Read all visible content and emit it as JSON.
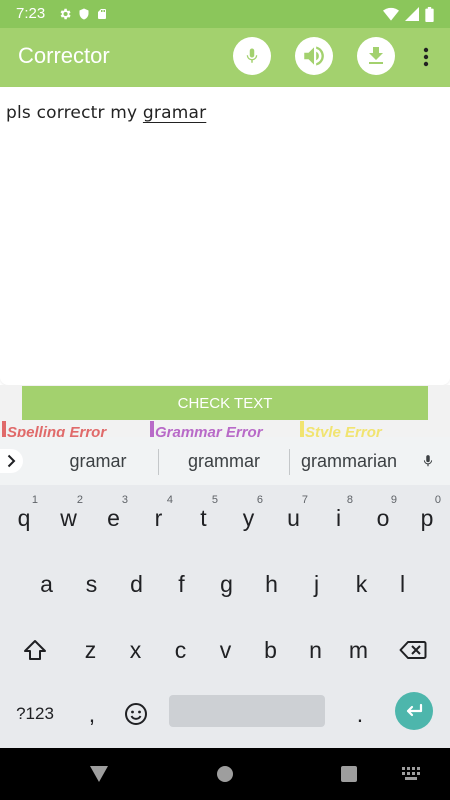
{
  "status_bar": {
    "time": "7:23",
    "left_icons": [
      "gear-icon",
      "shield-icon",
      "sd-card-icon"
    ],
    "right_icons": [
      "wifi-icon",
      "signal-icon",
      "battery-icon"
    ]
  },
  "app_bar": {
    "title": "Corrector",
    "actions": [
      "microphone-icon",
      "speaker-icon",
      "download-icon",
      "overflow-menu-icon"
    ]
  },
  "editor": {
    "text_plain": "pls correctr my ",
    "text_error": "gramar"
  },
  "check_button": {
    "label": "CHECK TEXT"
  },
  "legend": {
    "spelling": "Spelling Error",
    "grammar": "Grammar Error",
    "style": "Style Error"
  },
  "colors": {
    "app_bar": "#a3d16e",
    "status_bar": "#8bc65b",
    "spelling": "#e06a6a",
    "grammar": "#b86ac8",
    "style": "#f1e470",
    "enter_key": "#4db6ac"
  },
  "keyboard": {
    "suggestions": [
      "gramar",
      "grammar",
      "grammarian"
    ],
    "row1": [
      {
        "k": "q",
        "hint": "1"
      },
      {
        "k": "w",
        "hint": "2"
      },
      {
        "k": "e",
        "hint": "3"
      },
      {
        "k": "r",
        "hint": "4"
      },
      {
        "k": "t",
        "hint": "5"
      },
      {
        "k": "y",
        "hint": "6"
      },
      {
        "k": "u",
        "hint": "7"
      },
      {
        "k": "i",
        "hint": "8"
      },
      {
        "k": "o",
        "hint": "9"
      },
      {
        "k": "p",
        "hint": "0"
      }
    ],
    "row2": [
      "a",
      "s",
      "d",
      "f",
      "g",
      "h",
      "j",
      "k",
      "l"
    ],
    "row3": [
      "z",
      "x",
      "c",
      "v",
      "b",
      "n",
      "m"
    ],
    "row4": {
      "symbols": "?123",
      "comma": ",",
      "period": "."
    }
  }
}
